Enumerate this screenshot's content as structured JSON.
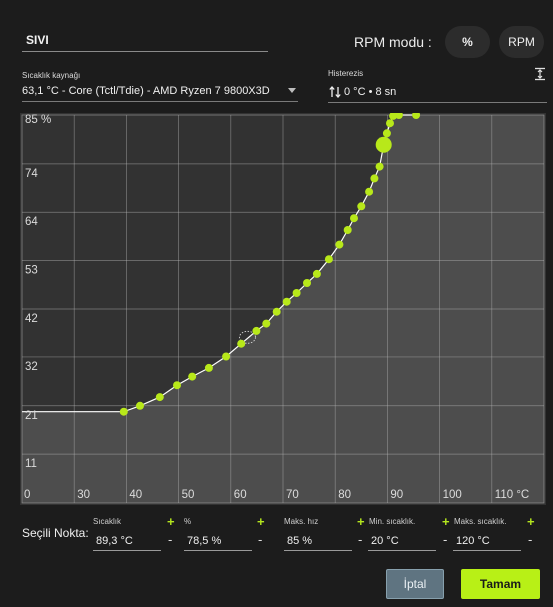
{
  "header": {
    "title": "SIVI",
    "rpm_mode_label": "RPM modu :",
    "mode_percent": "%",
    "mode_rpm": "RPM"
  },
  "source": {
    "label": "Sıcaklık kaynağı",
    "value": "63,1 °C - Core (Tctl/Tdie) - AMD Ryzen 7 9800X3D"
  },
  "hysteresis": {
    "label": "Histerezis",
    "value": "0 °C • 8 sn"
  },
  "icons": {
    "dropdown": "chevron-down-icon",
    "hysteresis": "up-down-arrows-icon",
    "fit": "fit-vertical-icon"
  },
  "chart_data": {
    "type": "line",
    "x_ticks": [
      "0",
      "30",
      "40",
      "50",
      "60",
      "70",
      "80",
      "90",
      "100",
      "110 °C"
    ],
    "y_ticks": [
      "85 %",
      "74",
      "64",
      "53",
      "42",
      "32",
      "21",
      "11"
    ],
    "xlim": [
      20,
      120
    ],
    "ylim": [
      0,
      85
    ],
    "grid": true,
    "flat_start": [
      [
        20,
        20
      ],
      [
        39.5,
        20
      ]
    ],
    "points": [
      [
        39.5,
        20.0
      ],
      [
        42.6,
        21.3
      ],
      [
        46.4,
        23.2
      ],
      [
        49.7,
        25.8
      ],
      [
        52.6,
        27.7
      ],
      [
        55.8,
        29.6
      ],
      [
        59.1,
        32.1
      ],
      [
        62.0,
        34.9
      ],
      [
        64.9,
        37.7
      ],
      [
        66.8,
        39.3
      ],
      [
        68.8,
        41.9
      ],
      [
        70.7,
        44.1
      ],
      [
        72.6,
        46.0
      ],
      [
        74.6,
        48.2
      ],
      [
        76.5,
        50.2
      ],
      [
        78.8,
        53.4
      ],
      [
        80.8,
        56.6
      ],
      [
        82.4,
        59.8
      ],
      [
        83.6,
        62.4
      ],
      [
        85.0,
        65.0
      ],
      [
        86.5,
        68.2
      ],
      [
        87.5,
        71.1
      ],
      [
        88.5,
        73.7
      ],
      [
        89.3,
        78.5
      ],
      [
        89.9,
        81.0
      ],
      [
        90.5,
        83.2
      ],
      [
        91.1,
        84.8
      ],
      [
        92.2,
        85.0
      ],
      [
        95.5,
        85.0
      ]
    ],
    "selected_index": 23,
    "hover_point": [
      63.2,
      36.3
    ],
    "line_color": "#ffffff",
    "point_color": "#b8e81a",
    "fill_color": "#4d4d4d",
    "plot_bg": "#323232",
    "grid_color": "#b8b8b8"
  },
  "selected_point": {
    "label": "Seçili Nokta:",
    "fields": [
      {
        "label": "Sıcaklık",
        "value": "89,3 °C"
      },
      {
        "label": "%",
        "value": "78,5 %"
      },
      {
        "label": "Maks. hız",
        "value": "85 %"
      },
      {
        "label": "Min. sıcaklık.",
        "value": "20 °C"
      },
      {
        "label": "Maks. sıcaklık.",
        "value": "120 °C"
      }
    ],
    "plus": "+",
    "minus": "-"
  },
  "buttons": {
    "cancel": "İptal",
    "ok": "Tamam"
  }
}
